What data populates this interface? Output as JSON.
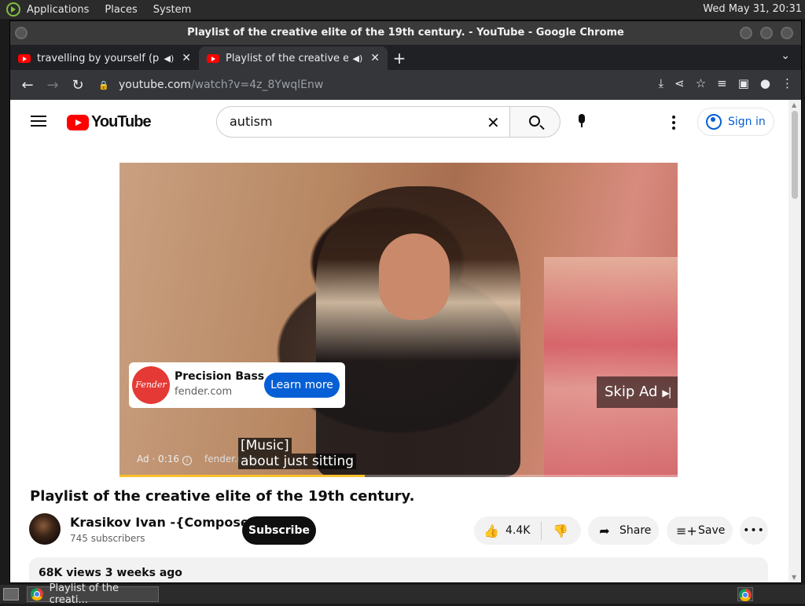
{
  "system_bar": {
    "menus": [
      "Applications",
      "Places",
      "System"
    ],
    "clock": "Wed May 31, 20:31"
  },
  "window": {
    "title": "Playlist of the creative elite of the 19th century. - YouTube - Google Chrome"
  },
  "tabs": [
    {
      "title": "travelling by yourself (play",
      "icon": "youtube-icon",
      "audio": "speaker-icon",
      "close": "✕",
      "active": false
    },
    {
      "title": "Playlist of the creative elite",
      "icon": "youtube-icon",
      "audio": "speaker-icon",
      "close": "✕",
      "active": true
    }
  ],
  "new_tab": "+",
  "tab_menu": "⌄",
  "nav": {
    "back": "←",
    "forward": "→",
    "reload": "↻"
  },
  "omnibox": {
    "host": "youtube.com",
    "path": "/watch?v=4z_8YwqlEnw",
    "icons": [
      "install-icon",
      "share-icon",
      "bookmark-star-icon",
      "media-control-icon",
      "side-panel-icon",
      "profile-icon",
      "menu-icon"
    ]
  },
  "youtube": {
    "logo_text": "YouTube",
    "search_value": "autism",
    "sign_in": "Sign in"
  },
  "ad": {
    "advertiser": "Precision Bass",
    "domain": "fender.com",
    "brand_logo_text": "Fender",
    "cta": "Learn more",
    "skip": "Skip Ad",
    "info": "Ad · 0:16",
    "source": "fender.com",
    "progress_fraction": 0.44
  },
  "captions": [
    "[Music]",
    "about just sitting"
  ],
  "video": {
    "title": "Playlist of the creative elite of the 19th century.",
    "channel": "Krasikov Ivan -{Composer}-",
    "subscribers": "745 subscribers",
    "subscribe": "Subscribe",
    "likes": "4.4K",
    "share": "Share",
    "save": "Save",
    "more": "•••",
    "views_date": "68K views  3 weeks ago"
  },
  "taskbar": {
    "task": "Playlist of the creati..."
  },
  "colors": {
    "youtube_red": "#ff0000",
    "link_blue": "#065fd4",
    "fender_red": "#e53935",
    "ad_progress": "#fbc02d"
  }
}
